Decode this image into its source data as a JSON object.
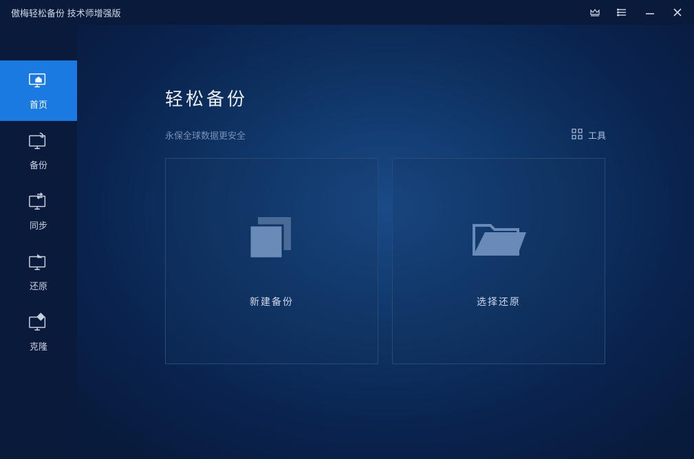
{
  "titlebar": {
    "app_name": "傲梅轻松备份 技术师增强版"
  },
  "sidebar": {
    "items": [
      {
        "label": "首页"
      },
      {
        "label": "备份"
      },
      {
        "label": "同步"
      },
      {
        "label": "还原"
      },
      {
        "label": "克隆"
      }
    ]
  },
  "page": {
    "title": "轻松备份",
    "subtitle": "永保全球数据更安全",
    "tools_label": "工具"
  },
  "cards": {
    "new_backup": "新建备份",
    "select_restore": "选择还原"
  }
}
